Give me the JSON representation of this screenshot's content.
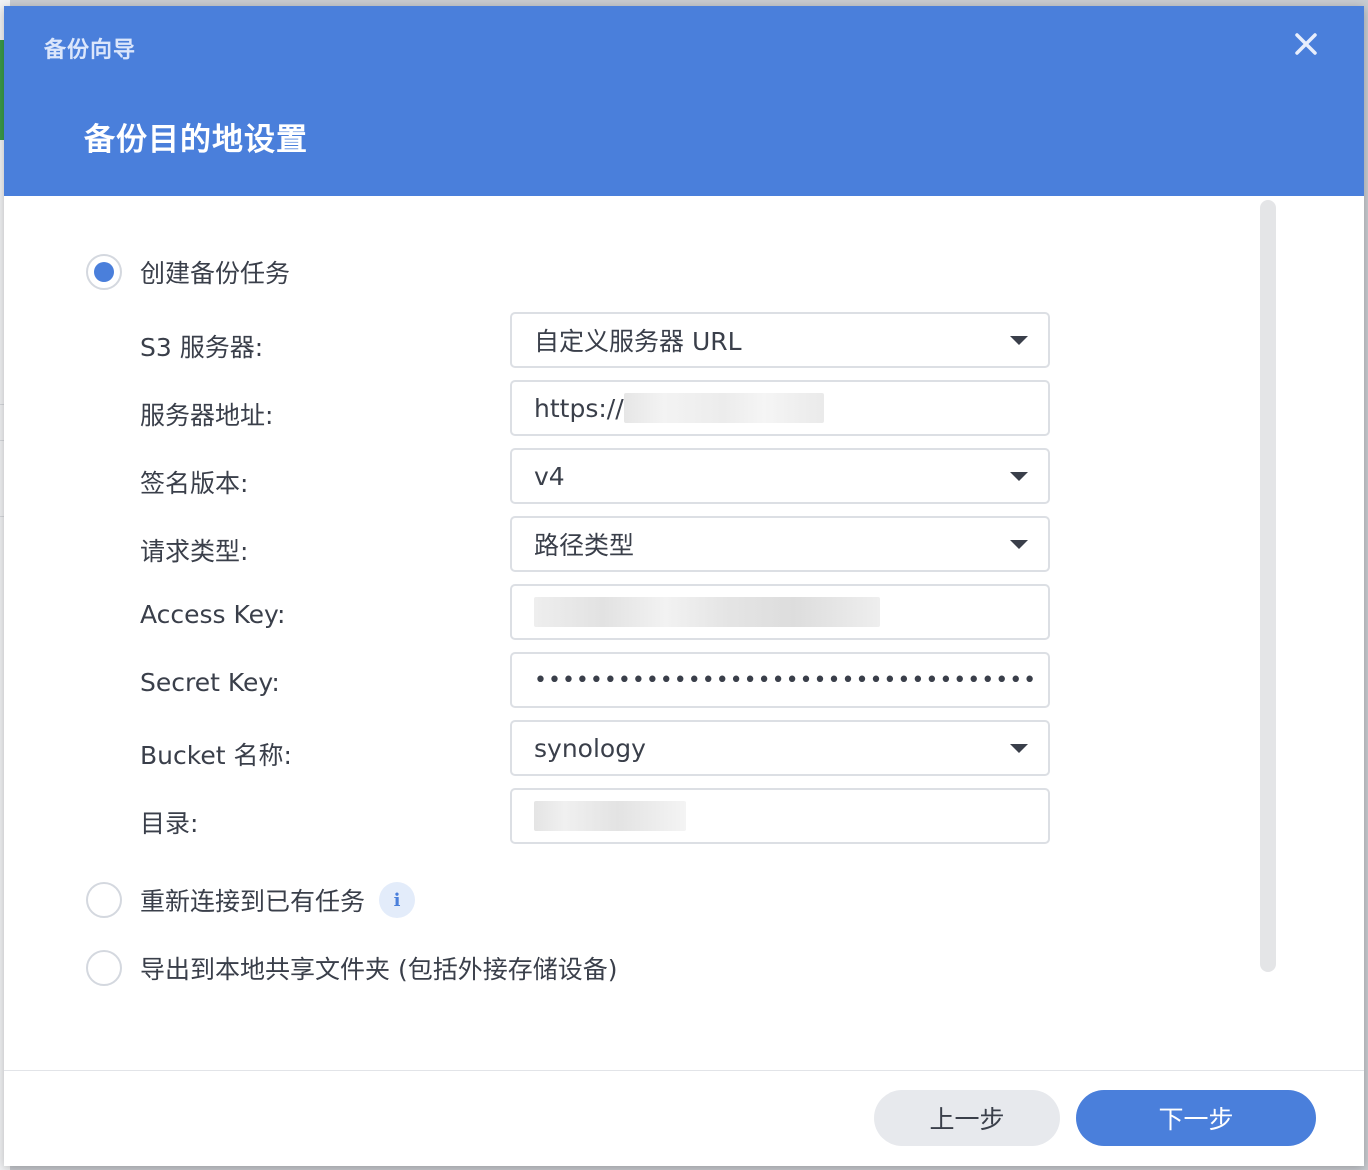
{
  "dialog": {
    "window_title": "备份向导",
    "step_title": "备份目的地设置"
  },
  "options": {
    "create": {
      "label": "创建备份任务",
      "selected": true
    },
    "reconnect": {
      "label": "重新连接到已有任务",
      "selected": false,
      "info_icon": "i"
    },
    "export": {
      "label": "导出到本地共享文件夹 (包括外接存储设备)",
      "selected": false
    }
  },
  "form": {
    "s3_server": {
      "label": "S3 服务器:",
      "value": "自定义服务器 URL"
    },
    "server_address": {
      "label": "服务器地址:",
      "value": "https://"
    },
    "signature_version": {
      "label": "签名版本:",
      "value": "v4"
    },
    "request_type": {
      "label": "请求类型:",
      "value": "路径类型"
    },
    "access_key": {
      "label": "Access Key:",
      "value": ""
    },
    "secret_key": {
      "label": "Secret Key:",
      "value": "••••••••••••••••••••••••••••••••••••••"
    },
    "bucket_name": {
      "label": "Bucket 名称:",
      "value": "synology"
    },
    "directory": {
      "label": "目录:",
      "value": ""
    }
  },
  "buttons": {
    "prev": "上一步",
    "next": "下一步"
  },
  "colors": {
    "accent": "#4a7fdb",
    "text": "#3a3f4a",
    "border": "#dcdfe4"
  }
}
